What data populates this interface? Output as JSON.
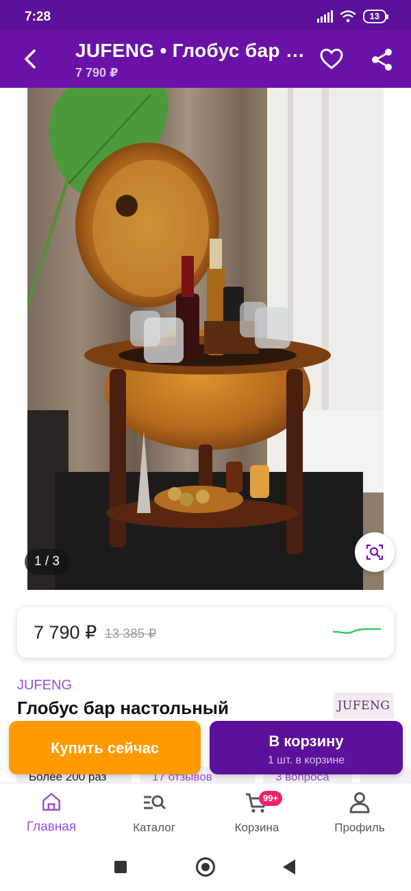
{
  "status_bar": {
    "time": "7:28",
    "battery": "13"
  },
  "header": {
    "title": "JUFENG • Глобус бар настольный",
    "price": "7 790 ₽"
  },
  "gallery": {
    "counter": "1 / 3"
  },
  "price_card": {
    "current": "7 790 ₽",
    "old": "13 385 ₽"
  },
  "product": {
    "brand": "JUFENG",
    "title": "Глобус бар настольный",
    "brand_logo": "JUFENG"
  },
  "chips": {
    "purchases": "Более 200 раз",
    "reviews": "17 отзывов",
    "questions": "3 вопроса"
  },
  "actions": {
    "buy_now": "Купить сейчас",
    "add_to_cart": "В корзину",
    "in_cart": "1 шт. в корзине"
  },
  "bottom_nav": {
    "home": "Главная",
    "catalog": "Каталог",
    "cart": "Корзина",
    "cart_badge": "99+",
    "profile": "Профиль"
  },
  "colors": {
    "brand_purple": "#6a12a8",
    "accent_orange": "#ff9a00",
    "link_purple": "#9b4fd3",
    "badge_pink": "#f0206c",
    "trend_green": "#2fcf5f"
  },
  "icons": [
    "back-arrow-icon",
    "heart-icon",
    "share-icon",
    "visual-search-icon",
    "home-icon",
    "catalog-search-icon",
    "cart-icon",
    "profile-icon"
  ]
}
